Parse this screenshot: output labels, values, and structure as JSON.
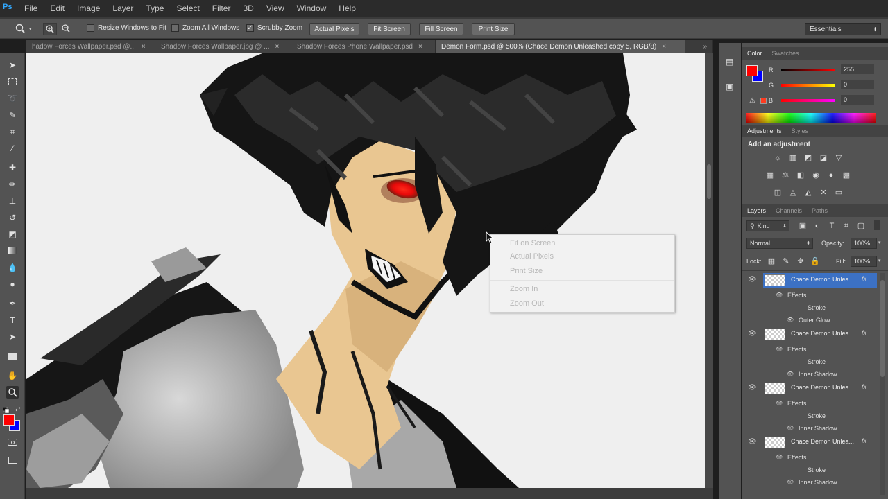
{
  "menubar": {
    "logo": "Ps",
    "items": [
      "File",
      "Edit",
      "Image",
      "Layer",
      "Type",
      "Select",
      "Filter",
      "3D",
      "View",
      "Window",
      "Help"
    ]
  },
  "options_bar": {
    "resize_windows_label": "Resize Windows to Fit",
    "resize_windows_checked": false,
    "zoom_all_label": "Zoom All Windows",
    "zoom_all_checked": false,
    "scrubby_zoom_label": "Scrubby Zoom",
    "scrubby_zoom_checked": true,
    "actual_pixels": "Actual Pixels",
    "fit_screen": "Fit Screen",
    "fill_screen": "Fill Screen",
    "print_size": "Print Size",
    "workspace": "Essentials"
  },
  "tabs": [
    {
      "label": "hadow Forces Wallpaper.psd @...",
      "active": false
    },
    {
      "label": "Shadow Forces Wallpaper.jpg @ ...",
      "active": false
    },
    {
      "label": "Shadow Forces Phone Wallpaper.psd",
      "active": false
    },
    {
      "label": "Demon Form.psd @ 500% (Chace Demon Unleashed copy 5, RGB/8)",
      "active": true
    }
  ],
  "tabs_overflow": "»",
  "context_menu": {
    "items": [
      "Fit on Screen",
      "Actual Pixels",
      "Print Size",
      "Zoom In",
      "Zoom Out"
    ]
  },
  "color_panel": {
    "tabs": [
      "Color",
      "Swatches"
    ],
    "channels": [
      {
        "label": "R",
        "value": "255",
        "gradient": [
          "#000000",
          "#ff0000"
        ],
        "level": 1.0
      },
      {
        "label": "G",
        "value": "0",
        "gradient": [
          "#ff0000",
          "#ffff00"
        ],
        "level": 0.0
      },
      {
        "label": "B",
        "value": "0",
        "gradient": [
          "#ff0000",
          "#ff00ff"
        ],
        "level": 0.0
      }
    ],
    "foreground": "#ff0000",
    "background": "#0000ff"
  },
  "adjustments_panel": {
    "tabs": [
      "Adjustments",
      "Styles"
    ],
    "heading": "Add an adjustment"
  },
  "layers_panel": {
    "tabs": [
      "Layers",
      "Channels",
      "Paths"
    ],
    "filter_kind": "Kind",
    "blend_mode": "Normal",
    "opacity_label": "Opacity:",
    "opacity_value": "100%",
    "lock_label": "Lock:",
    "fill_label": "Fill:",
    "fill_value": "100%",
    "layers": [
      {
        "name": "Chace Demon Unlea...",
        "fx": "fx",
        "effects_label": "Effects",
        "effects": [
          "Stroke",
          "Outer Glow"
        ],
        "selected": true
      },
      {
        "name": "Chace Demon Unlea...",
        "fx": "fx",
        "effects_label": "Effects",
        "effects": [
          "Stroke",
          "Inner Shadow"
        ],
        "selected": false
      },
      {
        "name": "Chace Demon Unlea...",
        "fx": "fx",
        "effects_label": "Effects",
        "effects": [
          "Stroke",
          "Inner Shadow"
        ],
        "selected": false
      },
      {
        "name": "Chace Demon Unlea...",
        "fx": "fx",
        "effects_label": "Effects",
        "effects": [
          "Stroke",
          "Inner Shadow"
        ],
        "selected": false
      }
    ]
  },
  "toolbox": {
    "foreground": "#ff0000",
    "background": "#0000ff"
  }
}
